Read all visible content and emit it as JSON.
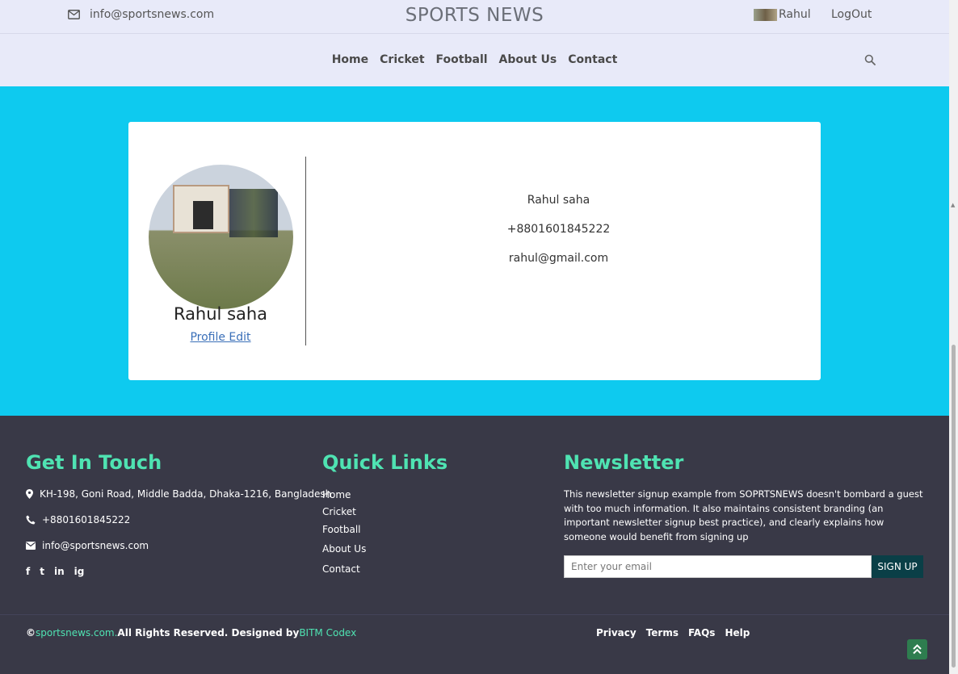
{
  "header": {
    "email": "info@sportsnews.com",
    "brand": "SPORTS NEWS",
    "user_name": "Rahul",
    "logout_label": "LogOut"
  },
  "nav": {
    "items": [
      "Home",
      "Cricket",
      "Football",
      "About Us",
      "Contact"
    ]
  },
  "profile": {
    "name": "Rahul saha",
    "edit_label": "Profile Edit",
    "info_name": "Rahul saha",
    "phone": "+8801601845222",
    "email": "rahul@gmail.com"
  },
  "footer": {
    "get_in_touch": {
      "title": "Get In Touch",
      "address": "KH-198, Goni Road, Middle Badda, Dhaka-1216, Bangladesh",
      "phone": "+8801601845222",
      "email": "info@sportsnews.com"
    },
    "social": [
      "f",
      "t",
      "in",
      "ig"
    ],
    "quick_links": {
      "title": "Quick Links",
      "items": [
        "Home",
        "Cricket",
        "Football",
        "About Us",
        "Contact"
      ]
    },
    "newsletter": {
      "title": "Newsletter",
      "text": "This newsletter signup example from SOPRTSNEWS doesn't bombard a guest with too much information. It also maintains consistent branding (an important newsletter signup best practice), and clearly explains how someone would benefit from signing up",
      "placeholder": "Enter your email",
      "button": "SIGN UP"
    },
    "copyright": {
      "symbol": "©",
      "site": "sportsnews.com.",
      "rights": "All Rights Reserved. Designed by",
      "designer": "BITM Codex"
    },
    "bottom_links": [
      "Privacy",
      "Terms",
      "FAQs",
      "Help"
    ]
  },
  "colors": {
    "header_bg": "#e8eaf9",
    "main_bg": "#0ecaef",
    "footer_bg": "#393947",
    "accent": "#4fe3b2",
    "link": "#3a6fb8",
    "signup_bg": "#0a3f47"
  }
}
